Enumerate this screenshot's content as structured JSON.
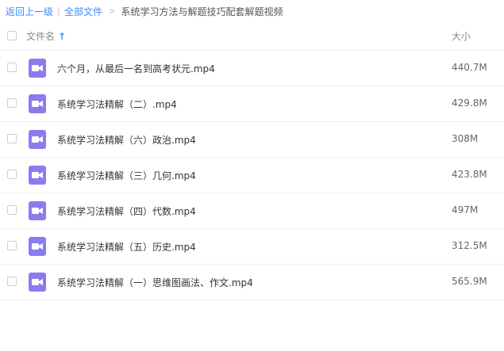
{
  "breadcrumb": {
    "back": "返回上一级",
    "separator": "|",
    "all_files": "全部文件",
    "arrow": ">",
    "current": "系统学习方法与解题技巧配套解题视频"
  },
  "header": {
    "name_label": "文件名",
    "sort_icon": "↑",
    "size_label": "大小"
  },
  "files": [
    {
      "name": "六个月，从最后一名到高考状元.mp4",
      "size": "440.7M"
    },
    {
      "name": "系统学习法精解（二）.mp4",
      "size": "429.8M"
    },
    {
      "name": "系统学习法精解（六）政治.mp4",
      "size": "308M"
    },
    {
      "name": "系统学习法精解（三）几何.mp4",
      "size": "423.8M"
    },
    {
      "name": "系统学习法精解（四）代数.mp4",
      "size": "497M"
    },
    {
      "name": "系统学习法精解（五）历史.mp4",
      "size": "312.5M"
    },
    {
      "name": "系统学习法精解（一）思维图画法、作文.mp4",
      "size": "565.9M"
    }
  ],
  "colors": {
    "link": "#3b8cff",
    "video_icon": "#8a7cf0"
  },
  "icons": {
    "file_type": "video-file-icon",
    "checkbox": "checkbox-icon",
    "sort": "arrow-up-icon"
  }
}
